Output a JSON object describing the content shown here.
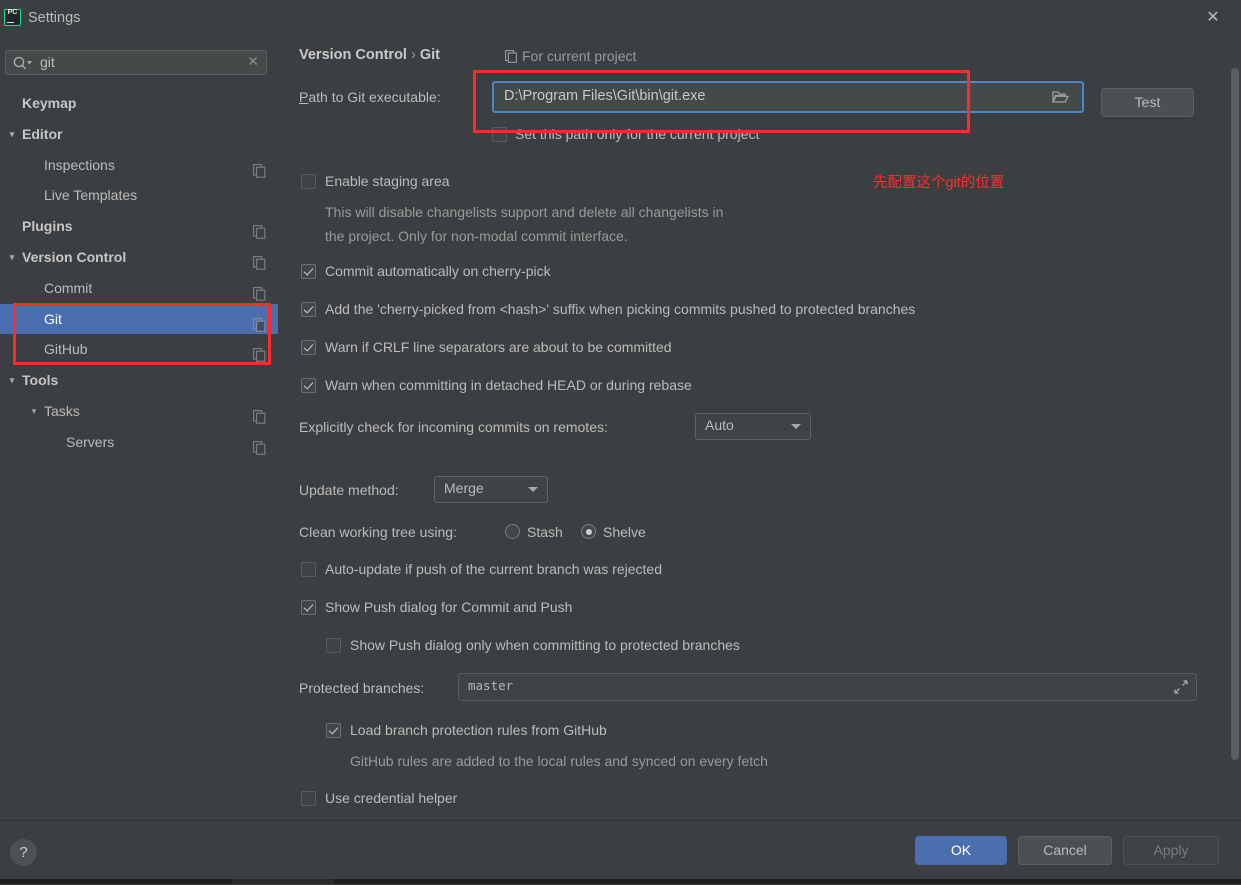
{
  "window": {
    "title": "Settings",
    "app_icon": "pycharm-icon",
    "close_icon": "close-icon"
  },
  "sidebar": {
    "search": {
      "value": "git",
      "icon": "search-icon",
      "clear_icon": "clear-icon"
    },
    "items": [
      {
        "label": "Keymap",
        "indent": 22,
        "bold": true,
        "chevron": "",
        "copy": false,
        "selected": false
      },
      {
        "label": "Editor",
        "indent": 22,
        "bold": true,
        "chevron": "v",
        "copy": false,
        "selected": false
      },
      {
        "label": "Inspections",
        "indent": 44,
        "bold": false,
        "chevron": "",
        "copy": true,
        "selected": false
      },
      {
        "label": "Live Templates",
        "indent": 44,
        "bold": false,
        "chevron": "",
        "copy": false,
        "selected": false
      },
      {
        "label": "Plugins",
        "indent": 22,
        "bold": true,
        "chevron": "",
        "copy": true,
        "selected": false
      },
      {
        "label": "Version Control",
        "indent": 22,
        "bold": true,
        "chevron": "v",
        "copy": true,
        "selected": false
      },
      {
        "label": "Commit",
        "indent": 44,
        "bold": false,
        "chevron": "",
        "copy": true,
        "selected": false
      },
      {
        "label": "Git",
        "indent": 44,
        "bold": false,
        "chevron": "",
        "copy": true,
        "selected": true
      },
      {
        "label": "GitHub",
        "indent": 44,
        "bold": false,
        "chevron": "",
        "copy": true,
        "selected": false
      },
      {
        "label": "Tools",
        "indent": 22,
        "bold": true,
        "chevron": "v",
        "copy": false,
        "selected": false
      },
      {
        "label": "Tasks",
        "indent": 44,
        "bold": false,
        "chevron": "v",
        "copy": true,
        "selected": false
      },
      {
        "label": "Servers",
        "indent": 66,
        "bold": false,
        "chevron": "",
        "copy": true,
        "selected": false
      }
    ]
  },
  "main": {
    "breadcrumb": {
      "root": "Version Control",
      "separator": "›",
      "leaf": "Git"
    },
    "for_current_project": {
      "label": "For current project",
      "icon": "copy-icon"
    },
    "path_row": {
      "label": "Path to Git executable:",
      "value": "D:\\Program Files\\Git\\bin\\git.exe",
      "browse_icon": "folder-icon",
      "test_button": "Test"
    },
    "set_path_only": {
      "label": "Set this path only for the current project",
      "checked": false
    },
    "enable_staging": {
      "label": "Enable staging area",
      "checked": false,
      "description_line1": "This will disable changelists support and delete all changelists in",
      "description_line2": "the project. Only for non-modal commit interface."
    },
    "checkboxes": [
      {
        "label": "Commit automatically on cherry-pick",
        "checked": true
      },
      {
        "label": "Add the 'cherry-picked from <hash>' suffix when picking commits pushed to protected branches",
        "checked": true
      },
      {
        "label": "Warn if CRLF line separators are about to be committed",
        "checked": true
      },
      {
        "label": "Warn when committing in detached HEAD or during rebase",
        "checked": true
      }
    ],
    "incoming_commits": {
      "label": "Explicitly check for incoming commits on remotes:",
      "value": "Auto"
    },
    "update_method": {
      "label": "Update method:",
      "value": "Merge"
    },
    "clean_working_tree": {
      "label": "Clean working tree using:",
      "options": [
        "Stash",
        "Shelve"
      ],
      "selected": "Shelve"
    },
    "auto_update": {
      "label": "Auto-update if push of the current branch was rejected",
      "checked": false
    },
    "show_push_dialog": {
      "label": "Show Push dialog for Commit and Push",
      "checked": true
    },
    "show_push_dialog_protected": {
      "label": "Show Push dialog only when committing to protected branches",
      "checked": false
    },
    "protected_branches": {
      "label": "Protected branches:",
      "value": "master",
      "expand_icon": "expand-icon"
    },
    "load_branch_rules": {
      "label": "Load branch protection rules from GitHub",
      "checked": true
    },
    "load_branch_rules_hint": "GitHub rules are added to the local rules and synced on every fetch",
    "use_credential_helper": {
      "label": "Use credential helper",
      "checked": false
    }
  },
  "annotation": {
    "text": "先配置这个git的位置",
    "color": "#ff2d2d"
  },
  "footer": {
    "help_icon": "help-icon",
    "ok": "OK",
    "cancel": "Cancel",
    "apply": "Apply"
  },
  "colors": {
    "background": "#3c3f41",
    "selection": "#4b6eaf",
    "accent_focus": "#4a88c7",
    "annotation_red": "#ff2d2d",
    "desktop": "#2b2b2b"
  }
}
